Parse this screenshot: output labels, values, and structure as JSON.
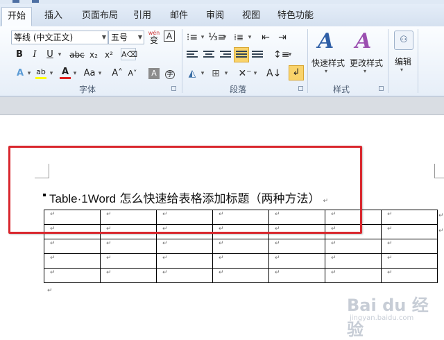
{
  "tabs": [
    "开始",
    "插入",
    "页面布局",
    "引用",
    "邮件",
    "审阅",
    "视图",
    "特色功能"
  ],
  "font_group": {
    "font_name": "等线 (中文正文)",
    "font_size": "五号",
    "wen_label": "wén",
    "wen_char": "变",
    "bold": "B",
    "italic": "I",
    "underline": "U",
    "strike": "abc",
    "sub": "x₂",
    "sup": "x²",
    "grow": "A˄",
    "shrink": "A˅",
    "aa": "Aa",
    "enclosed": "字",
    "label": "字体"
  },
  "para_group": {
    "label": "段落"
  },
  "styles_group": {
    "quick_styles": "快速样式",
    "change_styles": "更改样式",
    "label": "样式"
  },
  "edit_group": {
    "label": "编辑"
  },
  "document": {
    "heading_en": "Table·1Word",
    "heading_zh": " 怎么快速给表格添加标题（两种方法）",
    "cell_mark": "↵",
    "table": [
      [
        "↵",
        "↵",
        "↵",
        "↵",
        "↵",
        "↵",
        "↵"
      ],
      [
        "↵",
        "↵",
        "↵",
        "↵",
        "↵",
        "↵",
        "↵"
      ],
      [
        "↵",
        "↵",
        "↵",
        "↵",
        "↵",
        "↵",
        "↵"
      ],
      [
        "↵",
        "↵",
        "↵",
        "↵",
        "↵",
        "↵",
        "↵"
      ],
      [
        "↵",
        "↵",
        "↵",
        "↵",
        "↵",
        "↵",
        "↵"
      ]
    ]
  },
  "watermark": {
    "logo": "Bai du 经验",
    "url": "jingyan.baidu.com"
  },
  "colors": {
    "highlight": "#f9d36b",
    "annotation_red": "#d9272e",
    "ribbon": "#e6eef8"
  }
}
